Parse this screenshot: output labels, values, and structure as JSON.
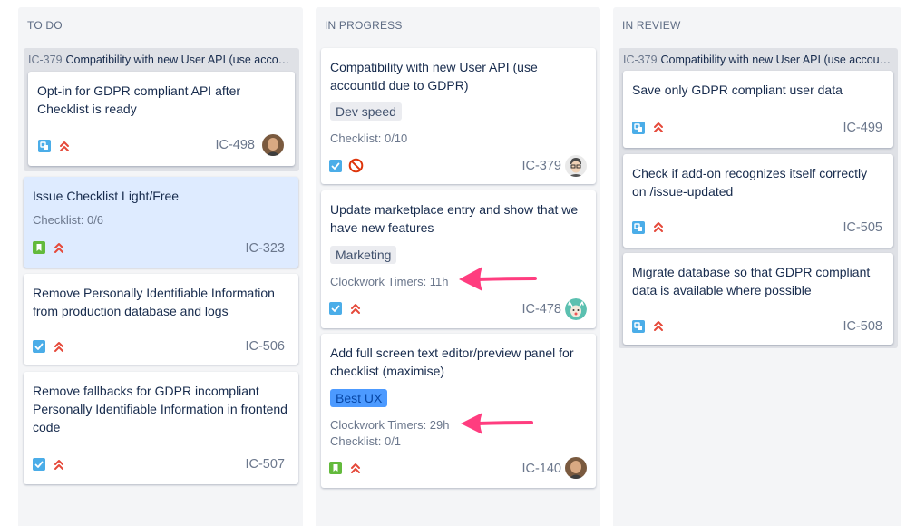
{
  "columns": [
    {
      "title": "TO DO"
    },
    {
      "title": "IN PROGRESS"
    },
    {
      "title": "IN REVIEW"
    }
  ],
  "todo": {
    "group": {
      "key": "IC-379",
      "summary": "Compatibility with new User API (use accountId due to GDPR)"
    },
    "cards": [
      {
        "summary": "Opt-in for GDPR compliant API after Checklist is ready",
        "key": "IC-498",
        "type": "subtask-icon",
        "priority": "highest-priority-icon"
      },
      {
        "summary": "Issue Checklist Light/Free",
        "checklist": "Checklist: 0/6",
        "key": "IC-323",
        "type": "story-icon",
        "priority": "highest-priority-icon"
      },
      {
        "summary": "Remove Personally Identifiable Information from production database and logs",
        "key": "IC-506",
        "type": "task-icon",
        "priority": "highest-priority-icon"
      },
      {
        "summary": "Remove fallbacks for GDPR incompliant Personally Identifiable Information in frontend code",
        "key": "IC-507",
        "type": "task-icon",
        "priority": "highest-priority-icon"
      }
    ]
  },
  "inprogress": {
    "cards": [
      {
        "summary": "Compatibility with new User API (use accountId due to GDPR)",
        "label": "Dev speed",
        "checklist": "Checklist: 0/10",
        "key": "IC-379",
        "type": "task-icon",
        "priority": "blocker-priority-icon"
      },
      {
        "summary": "Update marketplace entry and show that we have new features",
        "label": "Marketing",
        "timers": "Clockwork Timers: 11h",
        "key": "IC-478",
        "type": "task-icon",
        "priority": "highest-priority-icon"
      },
      {
        "summary": "Add full screen text editor/preview panel for checklist (maximise)",
        "label": "Best UX",
        "timers": "Clockwork Timers: 29h",
        "checklist": "Checklist: 0/1",
        "key": "IC-140",
        "type": "story-icon",
        "priority": "highest-priority-icon"
      }
    ]
  },
  "inreview": {
    "group": {
      "key": "IC-379",
      "summary": "Compatibility with new User API (use accountId due to GDPR)"
    },
    "cards": [
      {
        "summary": "Save only GDPR compliant user data",
        "key": "IC-499",
        "type": "subtask-icon",
        "priority": "highest-priority-icon"
      },
      {
        "summary": "Check if add-on recognizes itself correctly on /issue-updated",
        "key": "IC-505",
        "type": "subtask-icon",
        "priority": "highest-priority-icon"
      },
      {
        "summary": "Migrate database so that GDPR compliant data is available where possible",
        "key": "IC-508",
        "type": "subtask-icon",
        "priority": "highest-priority-icon"
      }
    ]
  },
  "colors": {
    "column_bg": "#f4f5f7",
    "group_bg": "#dfe1e6",
    "selected_card": "#deebff",
    "subtask": "#4bade8",
    "story": "#63ba3c",
    "task": "#4bade8",
    "priority": "#e5493a",
    "annotation_arrow": "#ff3d7f"
  }
}
